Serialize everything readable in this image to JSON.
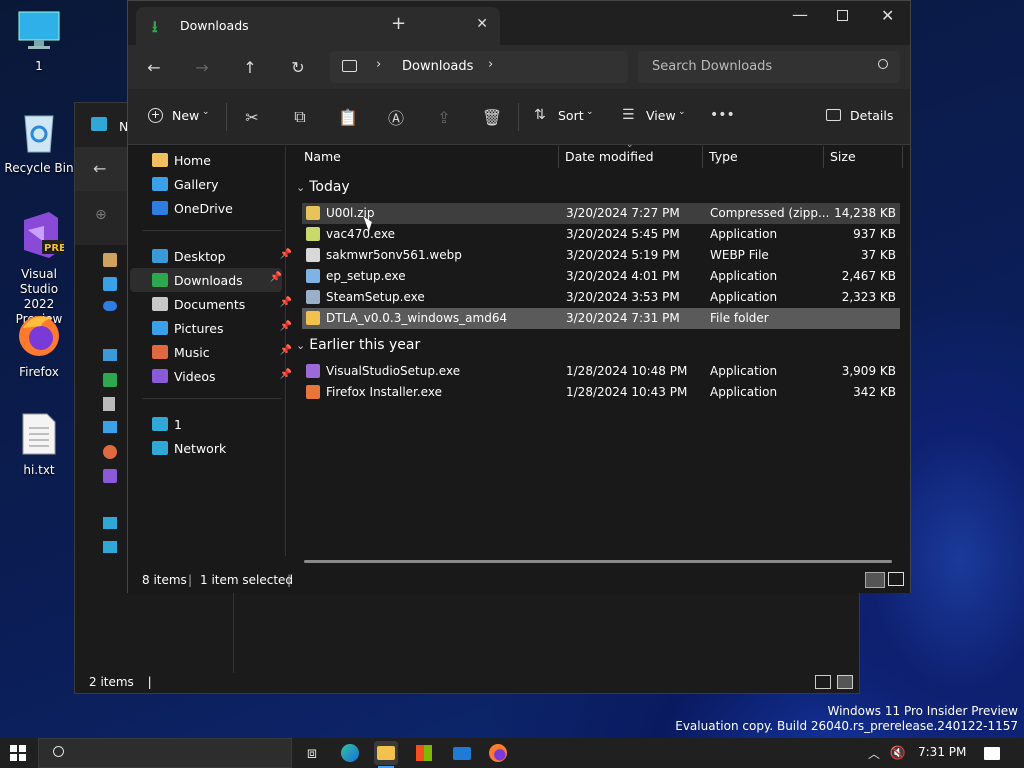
{
  "desktop": {
    "icons": [
      {
        "label": "1"
      },
      {
        "label": "Recycle Bin"
      },
      {
        "label": "Visual Studio 2022 Preview"
      },
      {
        "label": "Firefox"
      },
      {
        "label": "hi.txt"
      }
    ]
  },
  "back_window": {
    "title_initial": "N",
    "status": "2 items",
    "cursor": "|"
  },
  "window": {
    "tab_title": "Downloads",
    "new_tab": "+",
    "breadcrumb": "Downloads",
    "search_placeholder": "Search Downloads",
    "toolbar": {
      "new_label": "New",
      "sort_label": "Sort",
      "view_label": "View",
      "details_label": "Details",
      "more": "•••"
    },
    "sidebar": {
      "top": [
        {
          "label": "Home",
          "color": "#f0c060"
        },
        {
          "label": "Gallery",
          "color": "#3aa0e8"
        },
        {
          "label": "OneDrive",
          "color": "#2f7de0"
        }
      ],
      "quick": [
        {
          "label": "Desktop",
          "color": "#3a9ad9",
          "pinned": true
        },
        {
          "label": "Downloads",
          "color": "#2ea84f",
          "pinned": true
        },
        {
          "label": "Documents",
          "color": "#c8c8c8",
          "pinned": true
        },
        {
          "label": "Pictures",
          "color": "#3aa0e8",
          "pinned": true
        },
        {
          "label": "Music",
          "color": "#e06a40",
          "pinned": true
        },
        {
          "label": "Videos",
          "color": "#8a5ad8",
          "pinned": true
        }
      ],
      "bottom": [
        {
          "label": "1",
          "color": "#2fa8d8"
        },
        {
          "label": "Network",
          "color": "#2fa8d8"
        }
      ]
    },
    "columns": {
      "name": "Name",
      "date": "Date modified",
      "type": "Type",
      "size": "Size"
    },
    "groups": [
      {
        "title": "Today",
        "files": [
          {
            "name": "U00l.zip",
            "date": "3/20/2024 7:27 PM",
            "type": "Compressed (zipp...",
            "size": "14,238 KB",
            "color": "#e8c35a",
            "state": "hover"
          },
          {
            "name": "vac470.exe",
            "date": "3/20/2024 5:45 PM",
            "type": "Application",
            "size": "937 KB",
            "color": "#c9d96b",
            "state": ""
          },
          {
            "name": "sakmwr5onv561.webp",
            "date": "3/20/2024 5:19 PM",
            "type": "WEBP File",
            "size": "37 KB",
            "color": "#d8d8d8",
            "state": ""
          },
          {
            "name": "ep_setup.exe",
            "date": "3/20/2024 4:01 PM",
            "type": "Application",
            "size": "2,467 KB",
            "color": "#7fb3e8",
            "state": ""
          },
          {
            "name": "SteamSetup.exe",
            "date": "3/20/2024 3:53 PM",
            "type": "Application",
            "size": "2,323 KB",
            "color": "#9ab0c8",
            "state": ""
          },
          {
            "name": "DTLA_v0.0.3_windows_amd64",
            "date": "3/20/2024 7:31 PM",
            "type": "File folder",
            "size": "",
            "color": "#f2c14e",
            "state": "selected"
          }
        ]
      },
      {
        "title": "Earlier this year",
        "files": [
          {
            "name": "VisualStudioSetup.exe",
            "date": "1/28/2024 10:48 PM",
            "type": "Application",
            "size": "3,909 KB",
            "color": "#9b6ad8",
            "state": ""
          },
          {
            "name": "Firefox Installer.exe",
            "date": "1/28/2024 10:43 PM",
            "type": "Application",
            "size": "342 KB",
            "color": "#e8763a",
            "state": ""
          }
        ]
      }
    ],
    "status": {
      "items": "8 items",
      "selected": "1 item selected",
      "sep": "|"
    }
  },
  "watermark": {
    "line1": "Windows 11 Pro Insider Preview",
    "line2": "Evaluation copy. Build 26040.rs_prerelease.240122-1157"
  },
  "taskbar": {
    "time": "7:31 PM"
  }
}
